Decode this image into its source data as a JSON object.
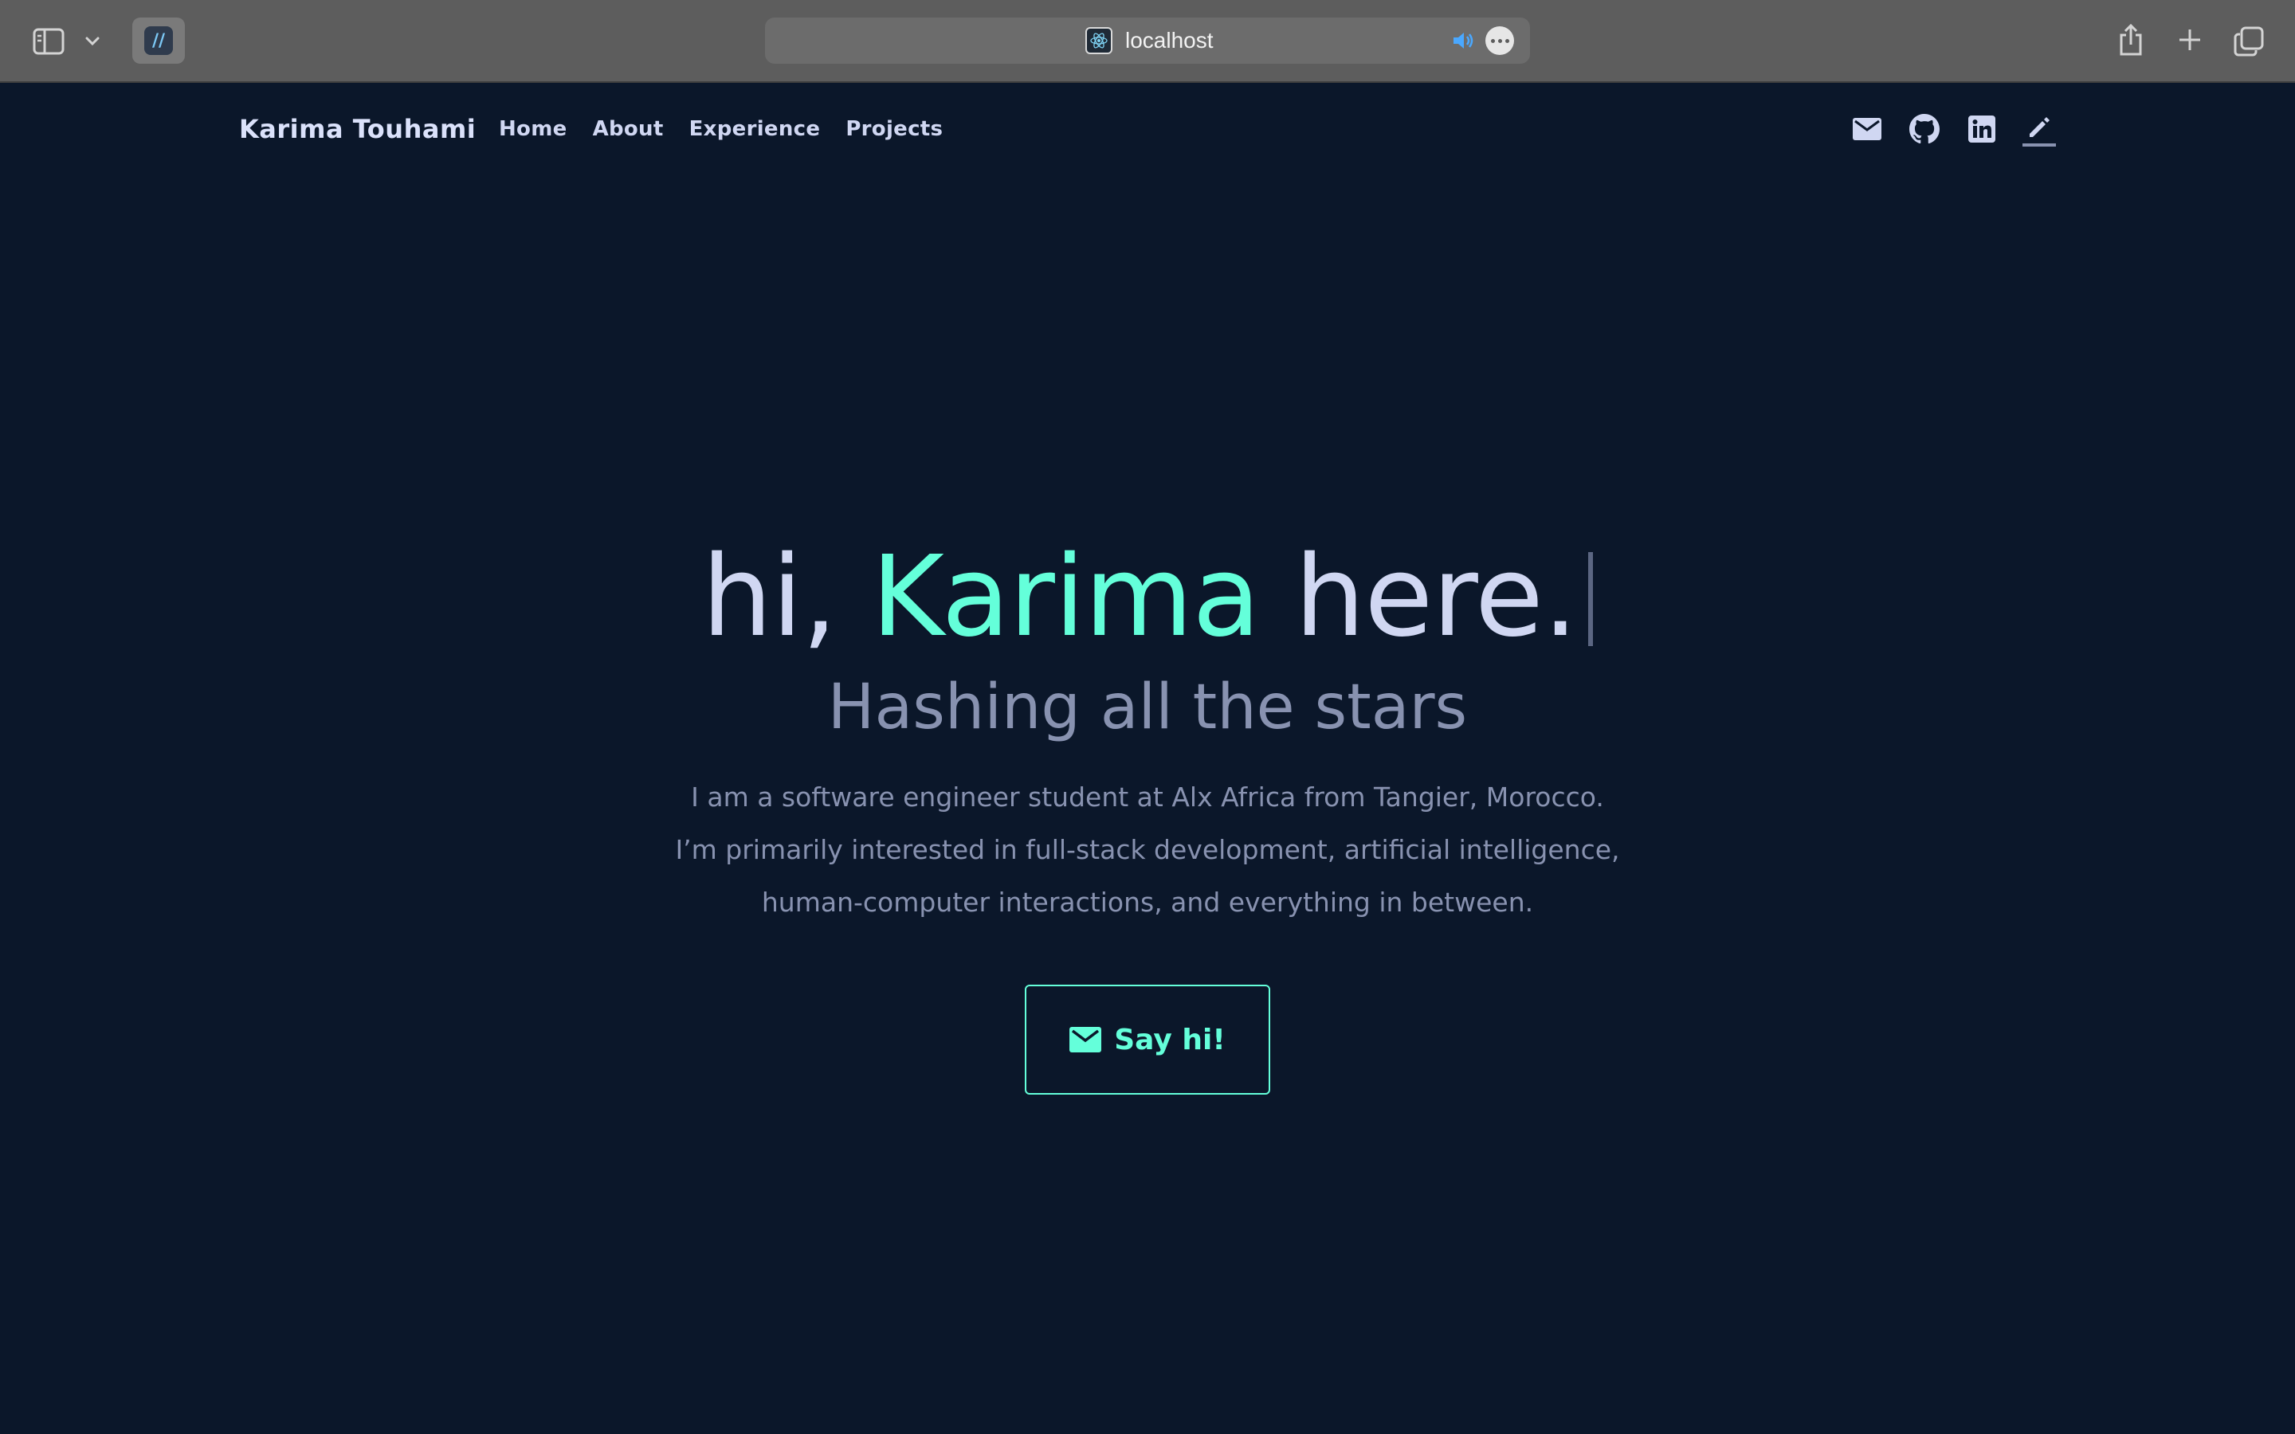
{
  "browser": {
    "address": "localhost",
    "icons": {
      "sidebar": "sidebar-icon",
      "sidebar_menu": "chevron-down-icon",
      "tab_favicon": "hashnode-favicon-icon",
      "site_favicon": "react-atom-icon",
      "audio": "speaker-icon",
      "more": "ellipsis-icon",
      "share": "share-icon",
      "new_tab": "plus-icon",
      "tab_overview": "tabs-overview-icon"
    }
  },
  "nav": {
    "brand": "Karima Touhami",
    "links": [
      {
        "label": "Home"
      },
      {
        "label": "About"
      },
      {
        "label": "Experience"
      },
      {
        "label": "Projects"
      }
    ],
    "icons": [
      "mail-icon",
      "github-icon",
      "linkedin-icon",
      "pen-icon"
    ]
  },
  "hero": {
    "greeting_prefix": "hi, ",
    "name": "Karima",
    "greeting_suffix": " here.",
    "subtitle": "Hashing all the stars",
    "description_lines": [
      "I am a software engineer student at Alx Africa from Tangier, Morocco.",
      "I’m primarily interested in full-stack development, artificial intelligence,",
      "human-computer interactions, and everything in between."
    ],
    "cta_label": "Say hi!"
  },
  "colors": {
    "background": "#0b172a",
    "accent": "#64ffda",
    "text_light": "#d0d7f2",
    "text_muted": "#8892b0",
    "chrome": "#5d5d5d"
  }
}
